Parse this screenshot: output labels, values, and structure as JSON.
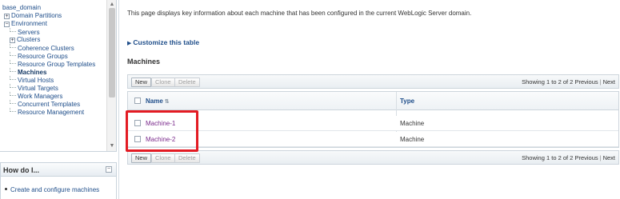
{
  "tree": {
    "items": [
      {
        "label": "base_domain",
        "level": 0,
        "expander": "",
        "bold": false
      },
      {
        "label": "Domain Partitions",
        "level": 1,
        "expander": "+",
        "bold": false
      },
      {
        "label": "Environment",
        "level": 1,
        "expander": "−",
        "bold": false
      },
      {
        "label": "Servers",
        "level": 2,
        "expander": "",
        "bold": false
      },
      {
        "label": "Clusters",
        "level": 2,
        "expander": "+",
        "bold": false
      },
      {
        "label": "Coherence Clusters",
        "level": 2,
        "expander": "",
        "bold": false
      },
      {
        "label": "Resource Groups",
        "level": 2,
        "expander": "",
        "bold": false
      },
      {
        "label": "Resource Group Templates",
        "level": 2,
        "expander": "",
        "bold": false
      },
      {
        "label": "Machines",
        "level": 2,
        "expander": "",
        "bold": true
      },
      {
        "label": "Virtual Hosts",
        "level": 2,
        "expander": "",
        "bold": false
      },
      {
        "label": "Virtual Targets",
        "level": 2,
        "expander": "",
        "bold": false
      },
      {
        "label": "Work Managers",
        "level": 2,
        "expander": "",
        "bold": false
      },
      {
        "label": "Concurrent Templates",
        "level": 2,
        "expander": "",
        "bold": false
      },
      {
        "label": "Resource Management",
        "level": 2,
        "expander": "",
        "bold": false
      }
    ]
  },
  "howdo": {
    "title": "How do I...",
    "links": [
      "Create and configure machines"
    ]
  },
  "main": {
    "description": "This page displays key information about each machine that has been configured in the current WebLogic Server domain.",
    "customize_label": "Customize this table",
    "section_title": "Machines",
    "toolbar": {
      "new_label": "New",
      "clone_label": "Clone",
      "delete_label": "Delete",
      "showing": "Showing 1 to 2 of 2",
      "previous": "Previous",
      "separator": "|",
      "next": "Next"
    },
    "table": {
      "columns": [
        "Name",
        "Type"
      ],
      "rows": [
        {
          "name": "Machine-1",
          "type": "Machine"
        },
        {
          "name": "Machine-2",
          "type": "Machine"
        }
      ]
    }
  },
  "colors": {
    "link": "#1f4e8a",
    "visited_link": "#7a2a8c",
    "highlight": "#e31b23"
  }
}
